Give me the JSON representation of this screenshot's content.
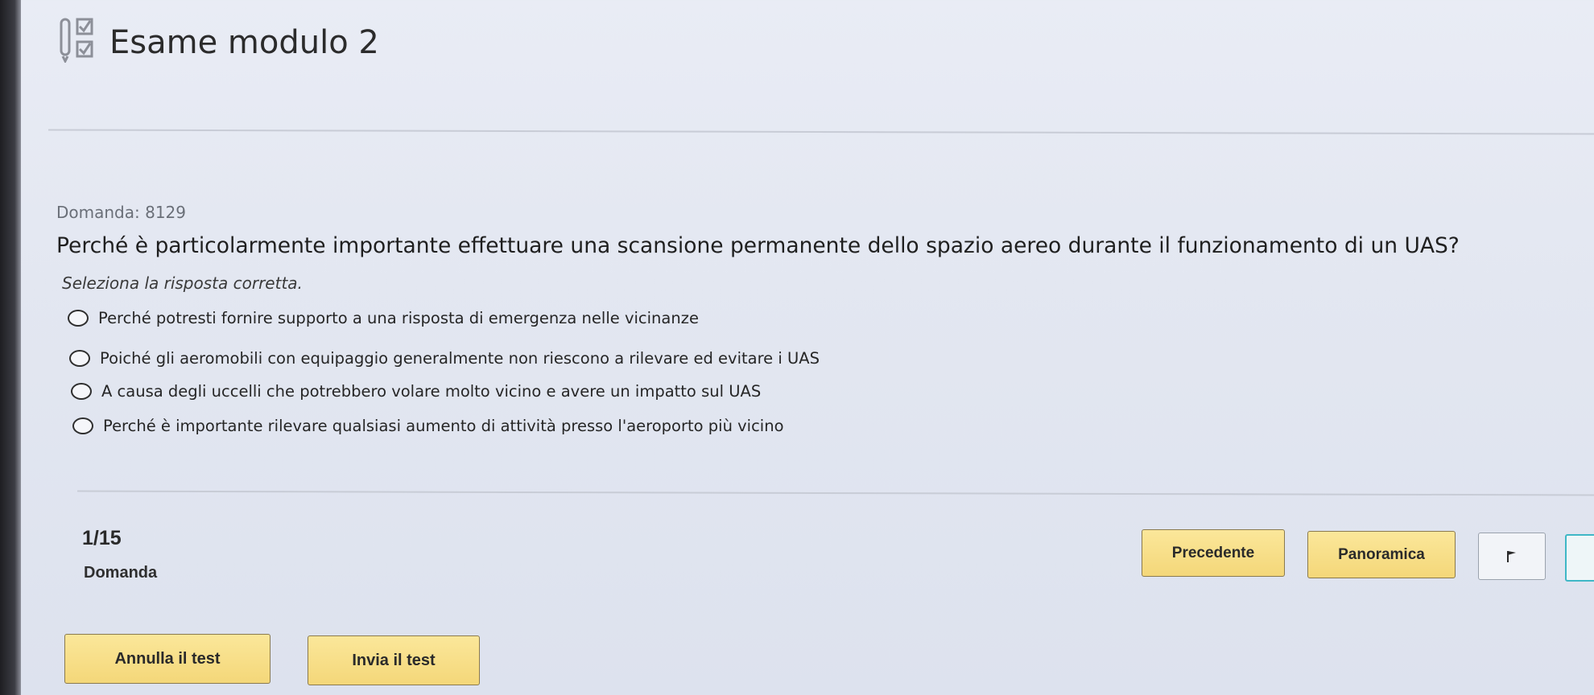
{
  "header": {
    "title": "Esame modulo 2",
    "icon": "exam-checklist-icon"
  },
  "question": {
    "id_text": "Domanda: 8129",
    "text": "Perché è particolarmente importante effettuare una scansione permanente dello spazio aereo durante il funzionamento di un UAS?",
    "instruction": "Seleziona la risposta corretta.",
    "options": [
      {
        "label": "Perché potresti fornire supporto a una risposta di emergenza nelle vicinanze",
        "selected": false
      },
      {
        "label": "Poiché gli aeromobili con equipaggio generalmente non riescono a rilevare ed evitare i UAS",
        "selected": false
      },
      {
        "label": "A causa degli uccelli che potrebbero volare molto vicino e avere un impatto sul UAS",
        "selected": false
      },
      {
        "label": "Perché è importante rilevare qualsiasi aumento di attività presso l'aeroporto più vicino",
        "selected": false
      }
    ]
  },
  "footer": {
    "counter": "1/15",
    "counter_label": "Domanda",
    "prev_label": "Precedente",
    "overview_label": "Panoramica",
    "flag_icon": "flag-icon",
    "cancel_label": "Annulla il test",
    "submit_label": "Invia il test"
  },
  "colors": {
    "button_fill": "#f4d779",
    "next_border": "#3fb7c6",
    "background": "#e3e7f1"
  }
}
